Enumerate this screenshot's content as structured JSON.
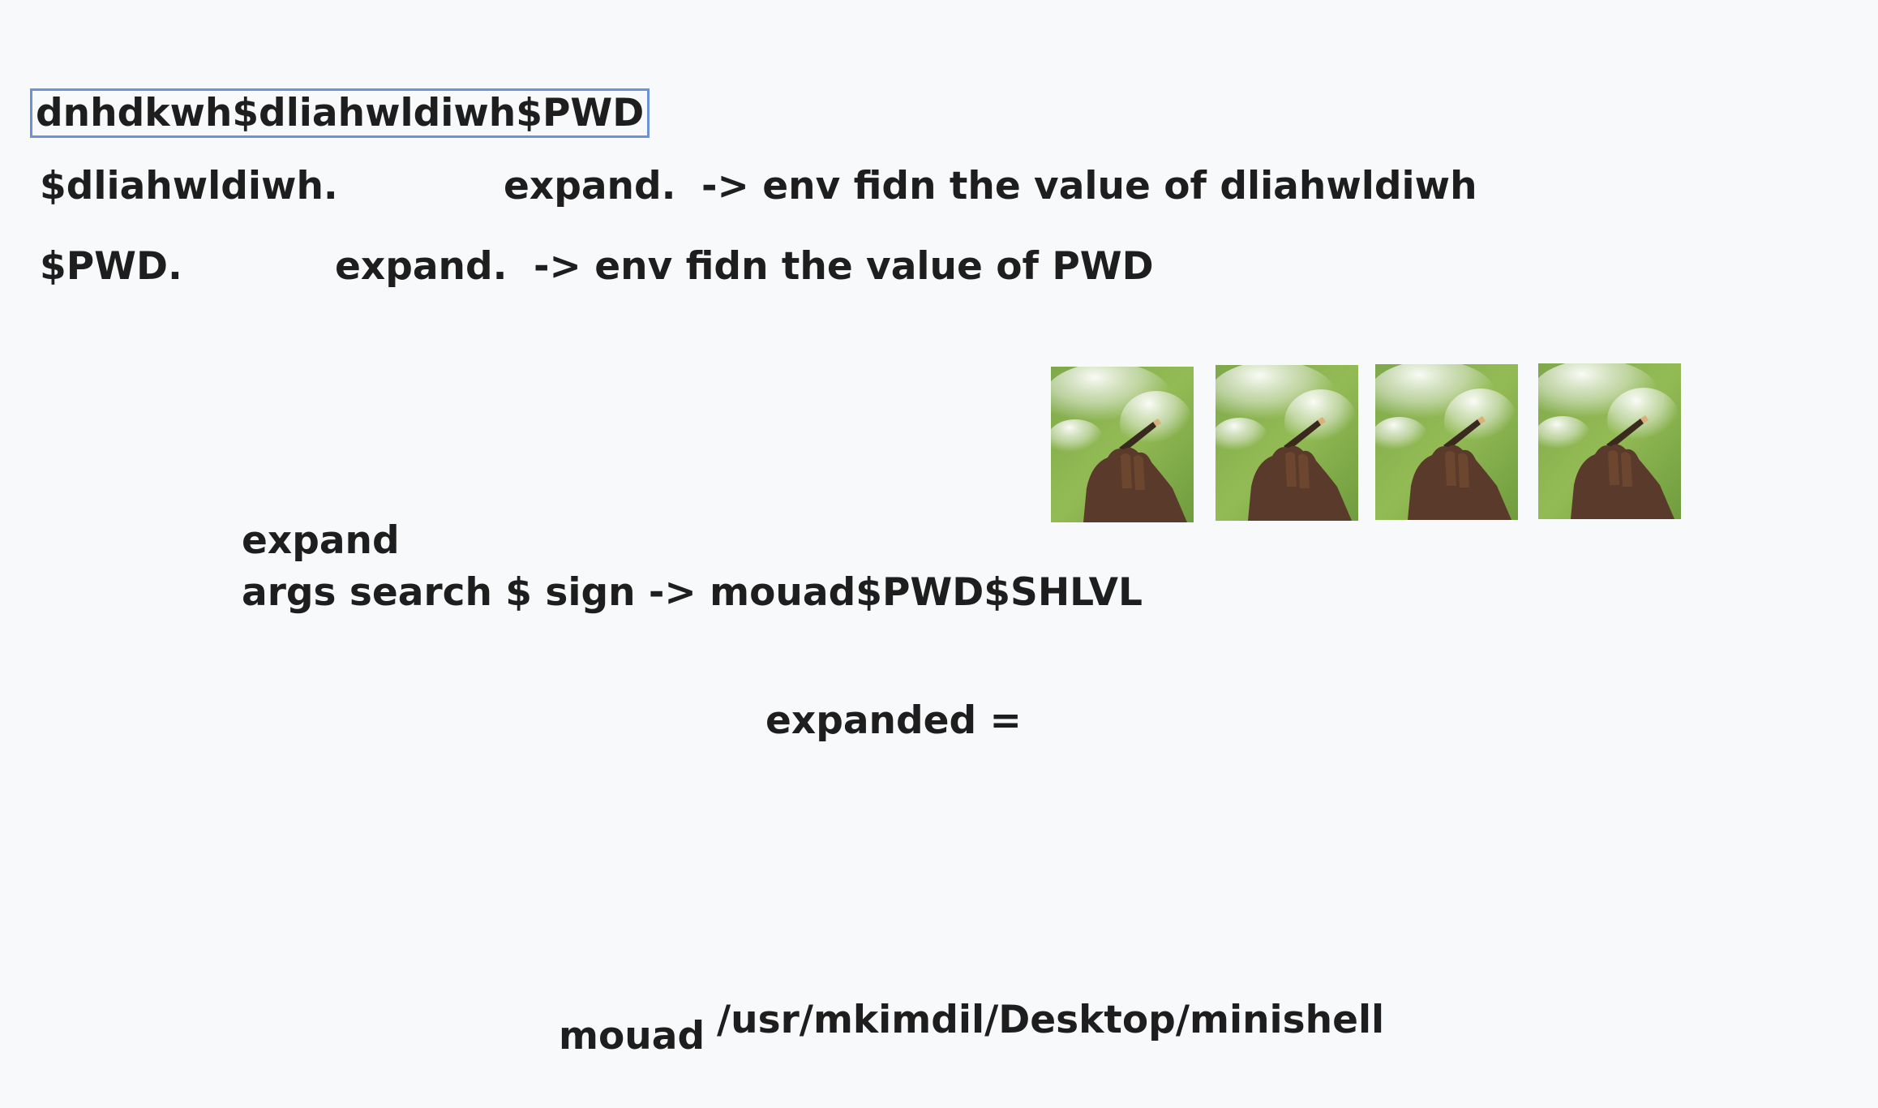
{
  "canvas": {
    "text_1": "dnhdkwh$dliahwldiwh$PWD",
    "text_2": "$dliahwldiwh.",
    "text_3": "expand.",
    "text_4": "-> env fidn the value of dliahwldiwh",
    "text_5": "$PWD.",
    "text_6": "expand.",
    "text_7": "-> env fidn the value of PWD",
    "text_8": "expand",
    "text_9": "args search $ sign -> mouad$PWD$SHLVL",
    "text_10": "expanded =",
    "text_11": "mouad",
    "text_12": "/usr/mkimdil/Desktop/minishell"
  },
  "images": [
    {
      "subject": "hand holding smoking cigarette"
    },
    {
      "subject": "hand holding smoking cigarette"
    },
    {
      "subject": "hand holding smoking cigarette"
    },
    {
      "subject": "hand holding smoking cigarette"
    }
  ],
  "colors": {
    "background": "#f8f9fa",
    "text": "#1e1e1e",
    "selection": "#6b93d6"
  }
}
